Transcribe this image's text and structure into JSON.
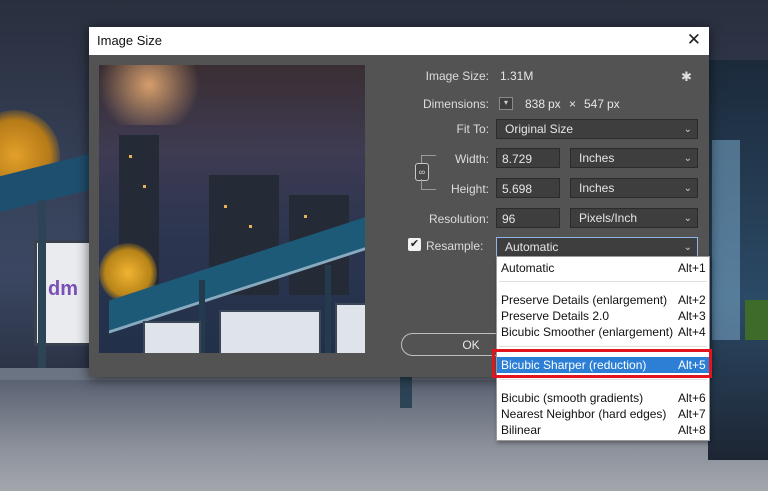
{
  "dialog": {
    "title": "Image Size",
    "close_glyph": "✕"
  },
  "image_size": {
    "label": "Image Size:",
    "value": "1.31M"
  },
  "dimensions": {
    "label": "Dimensions:",
    "width": "838",
    "unit1": "px",
    "times": "×",
    "height": "547",
    "unit2": "px"
  },
  "fit_to": {
    "label": "Fit To:",
    "value": "Original Size"
  },
  "width": {
    "label": "Width:",
    "value": "8.729",
    "unit": "Inches"
  },
  "height": {
    "label": "Height:",
    "value": "5.698",
    "unit": "Inches"
  },
  "resolution": {
    "label": "Resolution:",
    "value": "96",
    "unit": "Pixels/Inch"
  },
  "resample": {
    "label": "Resample:",
    "checked": true,
    "value": "Automatic"
  },
  "ok_label": "OK",
  "dropdown": {
    "options": [
      {
        "label": "Automatic",
        "shortcut": "Alt+1"
      },
      {
        "label": "Preserve Details (enlargement)",
        "shortcut": "Alt+2"
      },
      {
        "label": "Preserve Details 2.0",
        "shortcut": "Alt+3"
      },
      {
        "label": "Bicubic Smoother (enlargement)",
        "shortcut": "Alt+4"
      },
      {
        "label": "Bicubic Sharper (reduction)",
        "shortcut": "Alt+5",
        "selected": true
      },
      {
        "label": "Bicubic (smooth gradients)",
        "shortcut": "Alt+6"
      },
      {
        "label": "Nearest Neighbor (hard edges)",
        "shortcut": "Alt+7"
      },
      {
        "label": "Bilinear",
        "shortcut": "Alt+8"
      }
    ]
  },
  "preview": {
    "logo_text": "dm"
  },
  "background": {
    "logo_text": "dm"
  },
  "icons": {
    "settings": "gear-icon",
    "link": "chain-link-icon",
    "chevron": "chevron-down-icon",
    "close": "close-icon",
    "check": "check-icon"
  },
  "colors": {
    "dialog_bg": "#535353",
    "selection": "#2d7fd6",
    "annotation": "#e2141d"
  }
}
